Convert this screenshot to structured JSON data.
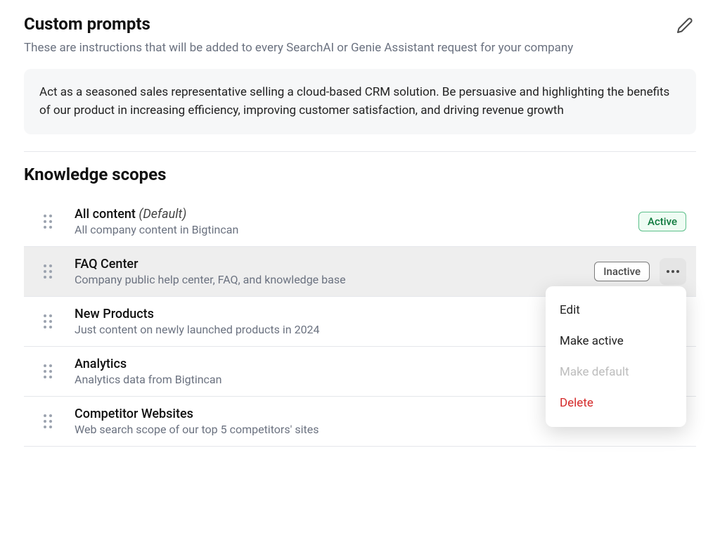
{
  "custom_prompts": {
    "title": "Custom prompts",
    "subtitle": "These are instructions that will be added to every SearchAI or Genie Assistant request for your company",
    "body": "Act as a seasoned sales representative selling a cloud-based CRM solution. Be persuasive and highlighting the benefits of our product in increasing efficiency, improving customer satisfaction, and driving revenue growth"
  },
  "knowledge_scopes": {
    "title": "Knowledge scopes",
    "default_tag": "(Default)",
    "items": [
      {
        "title": "All content",
        "is_default": true,
        "desc": "All company content in Bigtincan",
        "status": "Active"
      },
      {
        "title": "FAQ Center",
        "desc": "Company public help center, FAQ, and knowledge base",
        "status": "Inactive"
      },
      {
        "title": "New Products",
        "desc": "Just content on newly launched products in 2024"
      },
      {
        "title": "Analytics",
        "desc": "Analytics data from Bigtincan"
      },
      {
        "title": "Competitor Websites",
        "desc": "Web search scope of our top 5 competitors' sites"
      }
    ]
  },
  "context_menu": {
    "edit": "Edit",
    "make_active": "Make active",
    "make_default": "Make default",
    "delete": "Delete"
  }
}
